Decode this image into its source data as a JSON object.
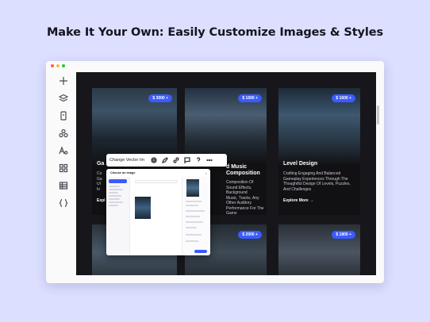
{
  "headline": "Make It Your Own: Easily Customize Images & Styles",
  "window": {
    "dots": [
      "#ff5f57",
      "#febc2e",
      "#28c840"
    ]
  },
  "toolrail": {
    "tools": [
      {
        "name": "add-icon"
      },
      {
        "name": "layers-icon"
      },
      {
        "name": "page-icon"
      },
      {
        "name": "components-icon"
      },
      {
        "name": "typography-icon"
      },
      {
        "name": "apps-grid-icon"
      },
      {
        "name": "table-icon"
      },
      {
        "name": "code-icon"
      }
    ]
  },
  "cards": [
    {
      "title": "Ga",
      "desc": "Co\nGa\nUI\nIn",
      "cta": "Expl",
      "price": "$ 3000 +"
    },
    {
      "title": "d Music\nComposition",
      "desc": "Composition Of Sound Effects, Background\nMusic, Tracks, Any Other Auditory\nPerformance For The Game",
      "cta": "",
      "price": "$ 1000 +"
    },
    {
      "title": "Level Design",
      "desc": "Crafting Engaging And Balanced\nGameplay Experiences Through The\nThoughtful Design Of Levels, Puzzles,\nAnd Challenges",
      "cta": "Explore More →",
      "price": "$ 1600 +"
    },
    {
      "title": "",
      "desc": "",
      "cta": "",
      "price": ""
    },
    {
      "title": "",
      "desc": "",
      "cta": "",
      "price": "$ 2000 +"
    },
    {
      "title": "",
      "desc": "",
      "cta": "",
      "price": "$ 1800 +"
    }
  ],
  "toolbar": {
    "change_label": "Change Vector Im",
    "icons": [
      "settings-icon",
      "pencil-icon",
      "link-icon",
      "comment-icon",
      "help-icon",
      "more-icon"
    ]
  },
  "dialog": {
    "title": "Choose an image",
    "close": "×"
  },
  "colors": {
    "accent": "#3b5bff",
    "background": "#dcdfff"
  }
}
